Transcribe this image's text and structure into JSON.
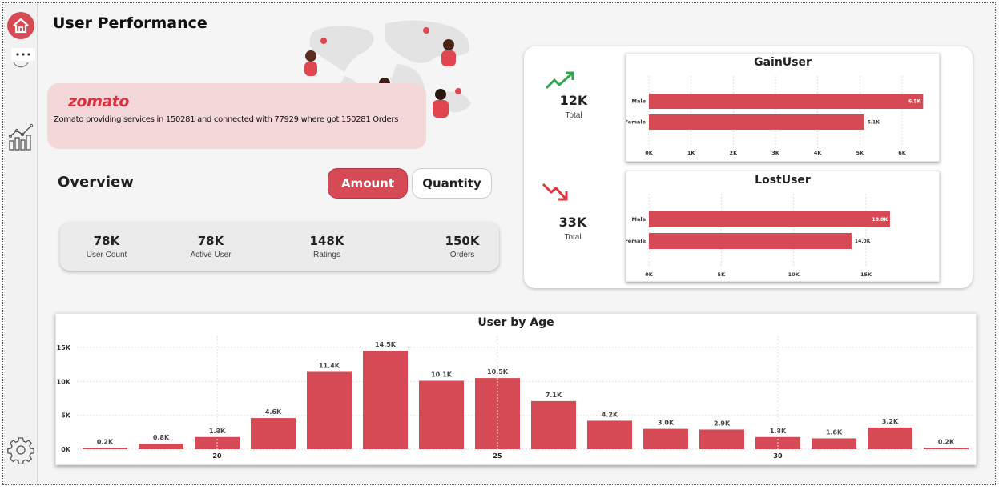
{
  "header": {
    "title": "User Performance"
  },
  "banner": {
    "brand": "zomato",
    "tagline": "Zomato providing services in 150281 and connected with 77929 where got 150281 Orders"
  },
  "overview": {
    "title": "Overview",
    "toggle": {
      "amount_label": "Amount",
      "quantity_label": "Quantity",
      "selected": "Amount"
    },
    "kpis": [
      {
        "value": "78K",
        "label": "User Count"
      },
      {
        "value": "78K",
        "label": "Active User"
      },
      {
        "value": "148K",
        "label": "Ratings"
      },
      {
        "value": "150K",
        "label": "Orders"
      }
    ]
  },
  "gain": {
    "value": "12K",
    "label": "Total"
  },
  "lost": {
    "value": "33K",
    "label": "Total"
  },
  "colors": {
    "accent": "#d64a55",
    "gain": "#2fa84f",
    "loss": "#e0343f"
  },
  "sidebar": {
    "icons": [
      "home-icon",
      "more-icon",
      "analytics-icon",
      "settings-icon"
    ]
  },
  "chart_data": [
    {
      "type": "bar",
      "orientation": "horizontal",
      "title": "GainUser",
      "categories": [
        "Male",
        "Female"
      ],
      "values": [
        6500,
        5100
      ],
      "data_labels": [
        "6.5K",
        "5.1K"
      ],
      "xlim": [
        0,
        6000
      ],
      "xticks": [
        "0K",
        "1K",
        "2K",
        "3K",
        "4K",
        "5K",
        "6K"
      ],
      "grid": true
    },
    {
      "type": "bar",
      "orientation": "horizontal",
      "title": "LostUser",
      "categories": [
        "Male",
        "Female"
      ],
      "values": [
        18800,
        14000
      ],
      "data_labels": [
        "18.8K",
        "14.0K"
      ],
      "xlim": [
        0,
        15000
      ],
      "xticks": [
        "0K",
        "5K",
        "10K",
        "15K"
      ],
      "grid": true
    },
    {
      "type": "bar",
      "title": "User by Age",
      "x": [
        18,
        19,
        20,
        21,
        22,
        23,
        24,
        25,
        26,
        27,
        28,
        29,
        30,
        31,
        32,
        33
      ],
      "values": [
        200,
        800,
        1800,
        4600,
        11400,
        14500,
        10100,
        10500,
        7100,
        4200,
        3000,
        2900,
        1800,
        1600,
        3200,
        200
      ],
      "data_labels": [
        "0.2K",
        "0.8K",
        "1.8K",
        "4.6K",
        "11.4K",
        "14.5K",
        "10.1K",
        "10.5K",
        "7.1K",
        "4.2K",
        "3.0K",
        "2.9K",
        "1.8K",
        "1.6K",
        "3.2K",
        "0.2K"
      ],
      "xtick_labels": [
        "20",
        "25",
        "30"
      ],
      "yticks": [
        "0K",
        "5K",
        "10K",
        "15K"
      ],
      "ylim": [
        0,
        15000
      ],
      "grid": true
    }
  ]
}
